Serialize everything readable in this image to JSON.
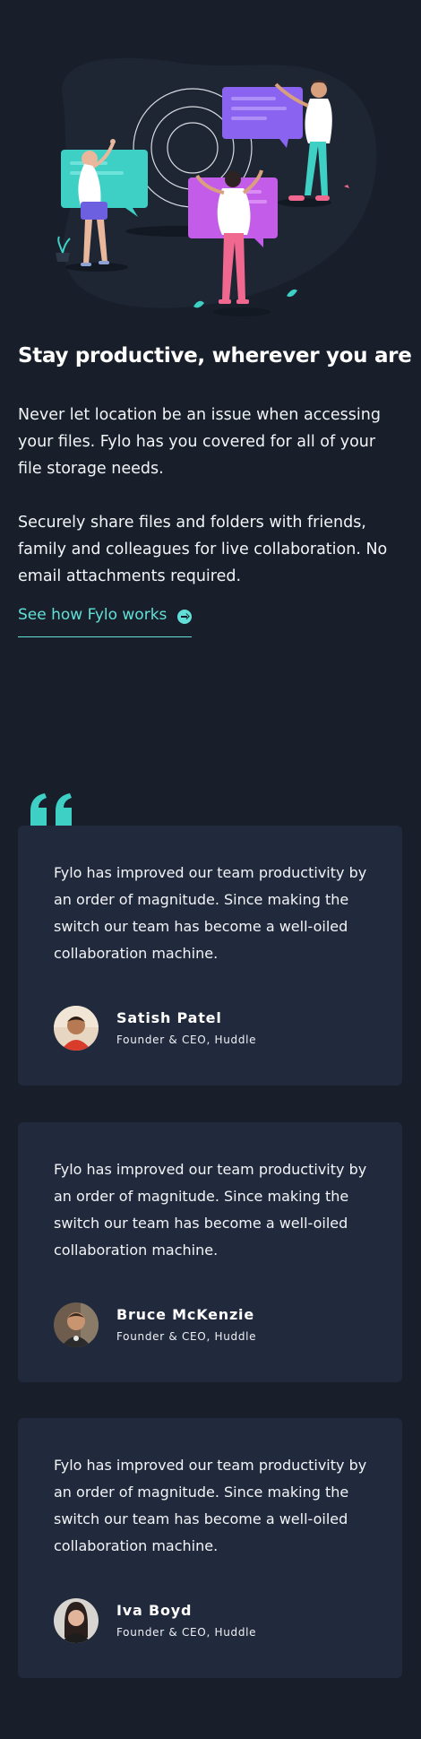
{
  "productive": {
    "heading": "Stay productive, wherever you are",
    "paragraph1": "Never let location be an issue when accessing your files. Fylo has you covered for all of your file storage needs.",
    "paragraph2": "Securely share files and folders with friends, family and colleagues for live collaboration. No email attachments required.",
    "link_label": "See how Fylo works",
    "link_icon": "arrow-right-circle-icon"
  },
  "testimonials": {
    "quote_icon": "quote-icon",
    "items": [
      {
        "text": "Fylo has improved our team productivity by an order of magnitude. Since making the switch our team has become a well-oiled collaboration machine.",
        "name": "Satish Patel",
        "role": "Founder & CEO, Huddle"
      },
      {
        "text": "Fylo has improved our team productivity by an order of magnitude. Since making the switch our team has become a well-oiled collaboration machine.",
        "name": "Bruce McKenzie",
        "role": "Founder & CEO, Huddle"
      },
      {
        "text": "Fylo has improved our team productivity by an order of magnitude. Since making the switch our team has become a well-oiled collaboration machine.",
        "name": "Iva Boyd",
        "role": "Founder & CEO, Huddle"
      }
    ]
  },
  "colors": {
    "background": "#181f2a",
    "card": "#21293c",
    "accent": "#62e0d8"
  }
}
